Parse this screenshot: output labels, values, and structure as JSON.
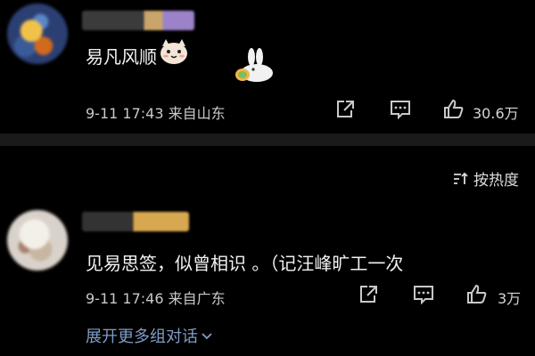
{
  "comments": [
    {
      "text": "易凡风顺",
      "date": "9-11 17:43",
      "location": "来自山东",
      "likes": "30.6万"
    },
    {
      "text": "见易思签，似曾相识 。（记汪峰旷工一次",
      "date": "9-11 17:46",
      "location": "来自广东",
      "likes": "3万"
    }
  ],
  "sort": {
    "label": "按热度"
  },
  "thread": {
    "expand_label": "展开更多组对话"
  },
  "colors": {
    "link": "#7f9dc7",
    "divider": "#1a1a1a"
  },
  "icons": [
    "share-icon",
    "comment-icon",
    "like-icon",
    "sort-icon",
    "chevron-down-icon"
  ]
}
